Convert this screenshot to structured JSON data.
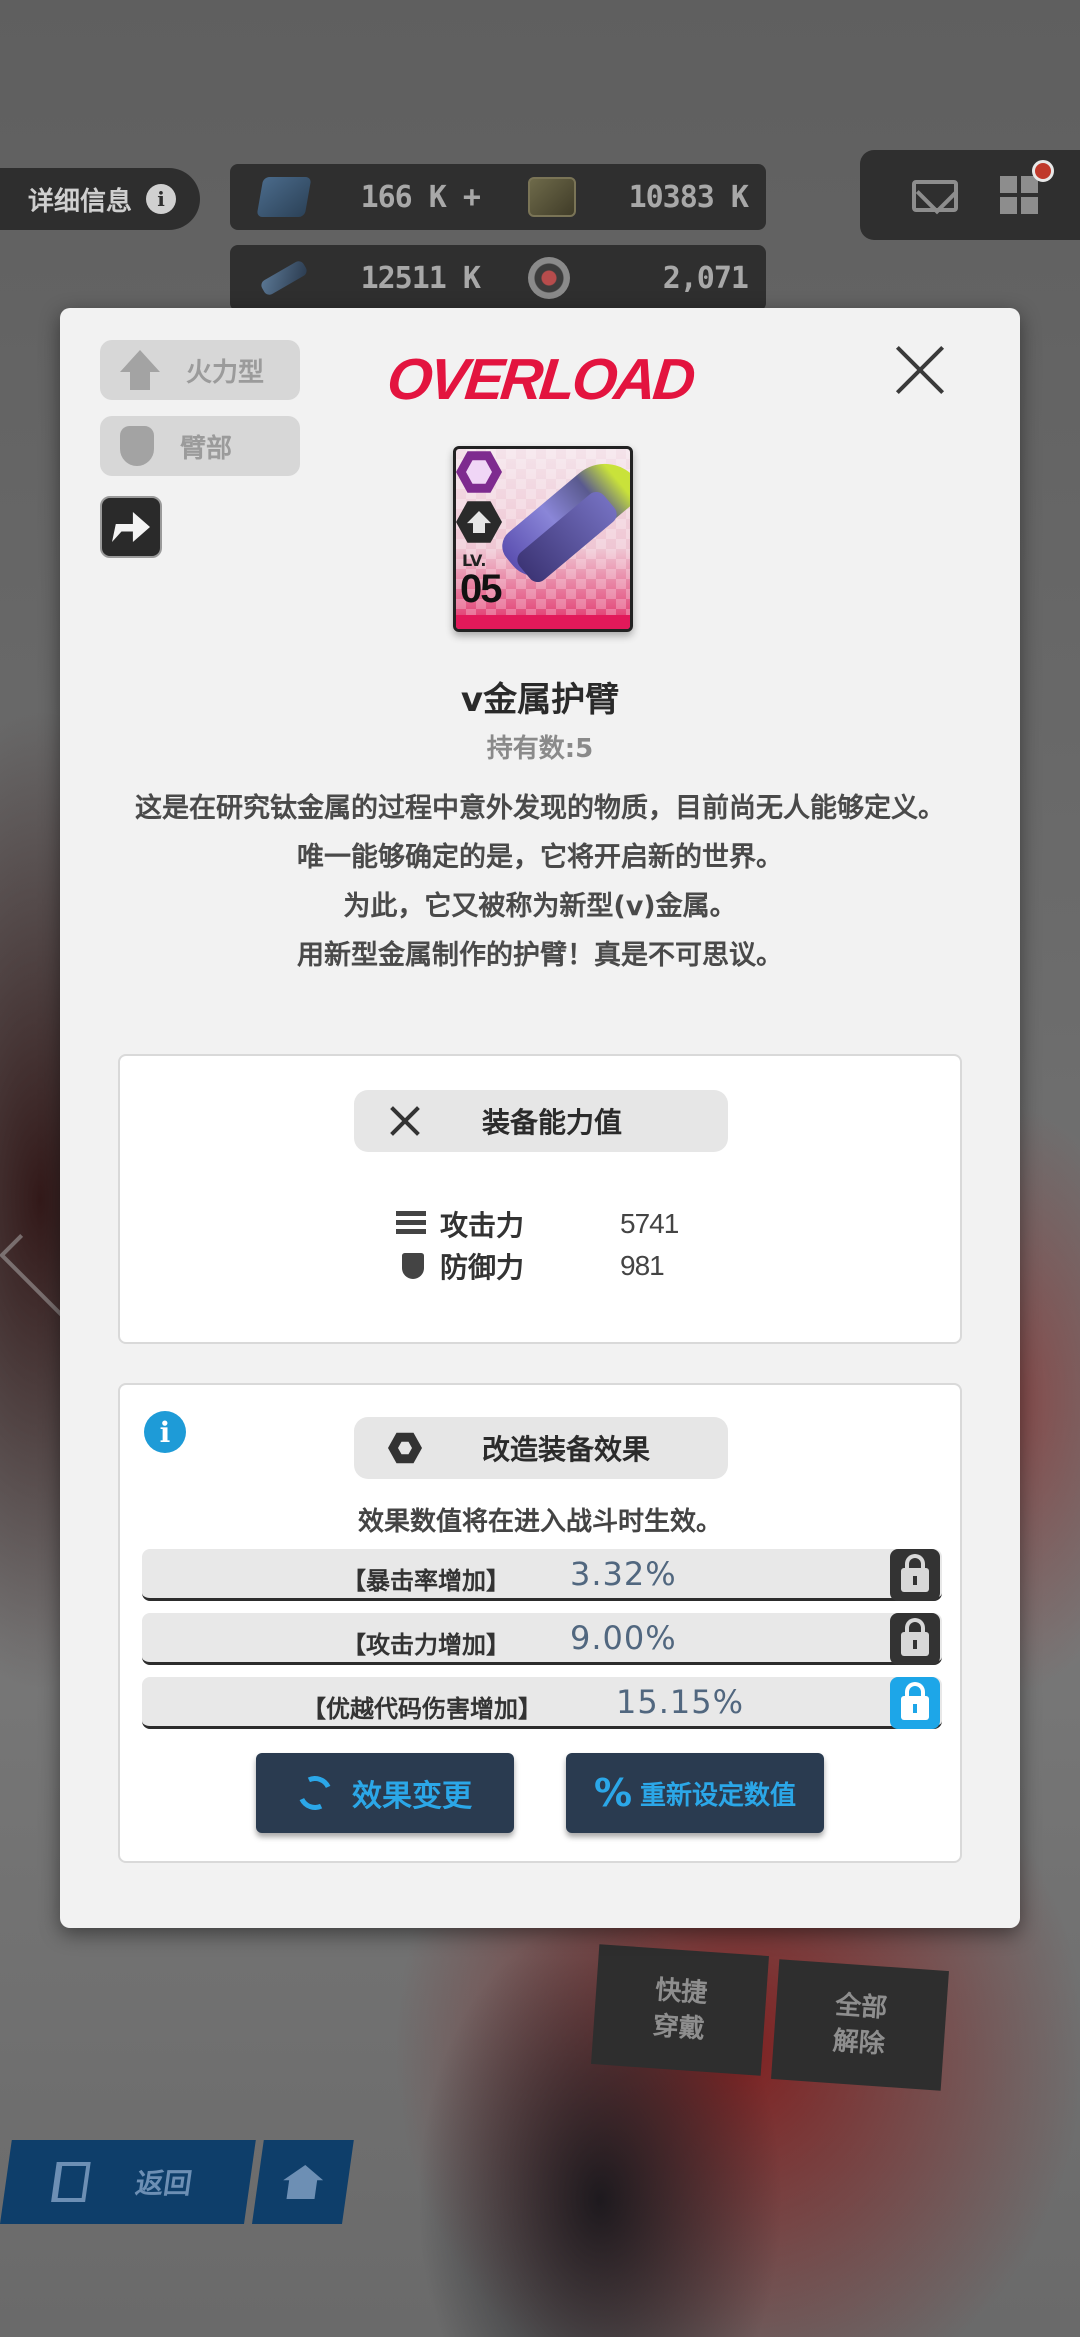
{
  "hud": {
    "info_label": "详细信息",
    "info_icon": "i",
    "currencies": [
      {
        "icon": "crystal-icon",
        "value": "166 K +"
      },
      {
        "icon": "ticket-icon",
        "value": "10383 K"
      },
      {
        "icon": "wand-icon",
        "value": "12511 K"
      },
      {
        "icon": "orb-icon",
        "value": "2,071"
      }
    ],
    "has_notification": true
  },
  "modal": {
    "tags": [
      {
        "icon": "firepower-icon",
        "label": "火力型"
      },
      {
        "icon": "arm-icon",
        "label": "臂部"
      }
    ],
    "logo_text": "OVERLOAD",
    "item": {
      "lv_label": "LV.",
      "level": "05",
      "name": "v金属护臂",
      "owned": "持有数:5",
      "description": [
        "这是在研究钛金属的过程中意外发现的物质，目前尚无人能够定义。",
        "唯一能够确定的是，它将开启新的世界。",
        "为此，它又被称为新型(v)金属。",
        "用新型金属制作的护臂！真是不可思议。"
      ]
    },
    "stats_panel": {
      "title": "装备能力值",
      "stats": [
        {
          "icon": "attack-icon",
          "label": "攻击力",
          "value": "5741"
        },
        {
          "icon": "shield-icon",
          "label": "防御力",
          "value": "981"
        }
      ]
    },
    "mods_panel": {
      "info_icon": "i",
      "title": "改造装备效果",
      "note": "效果数值将在进入战斗时生效。",
      "effects": [
        {
          "name": "【暴击率增加】",
          "value": "3.32%",
          "locked": false
        },
        {
          "name": "【攻击力增加】",
          "value": "9.00%",
          "locked": false
        },
        {
          "name": "【优越代码伤害增加】",
          "value": "15.15%",
          "locked": true
        }
      ],
      "change_label": "效果变更",
      "reset_label": "重新设定数值",
      "reset_icon": "%"
    }
  },
  "bottom": {
    "back_label": "返回",
    "quick_equip": [
      "快捷",
      "穿戴"
    ],
    "remove_all": [
      "全部",
      "解除"
    ]
  },
  "colors": {
    "accent": "#1da6e8",
    "logo_red": "#e3143f",
    "button_dark": "#2a3b50"
  }
}
